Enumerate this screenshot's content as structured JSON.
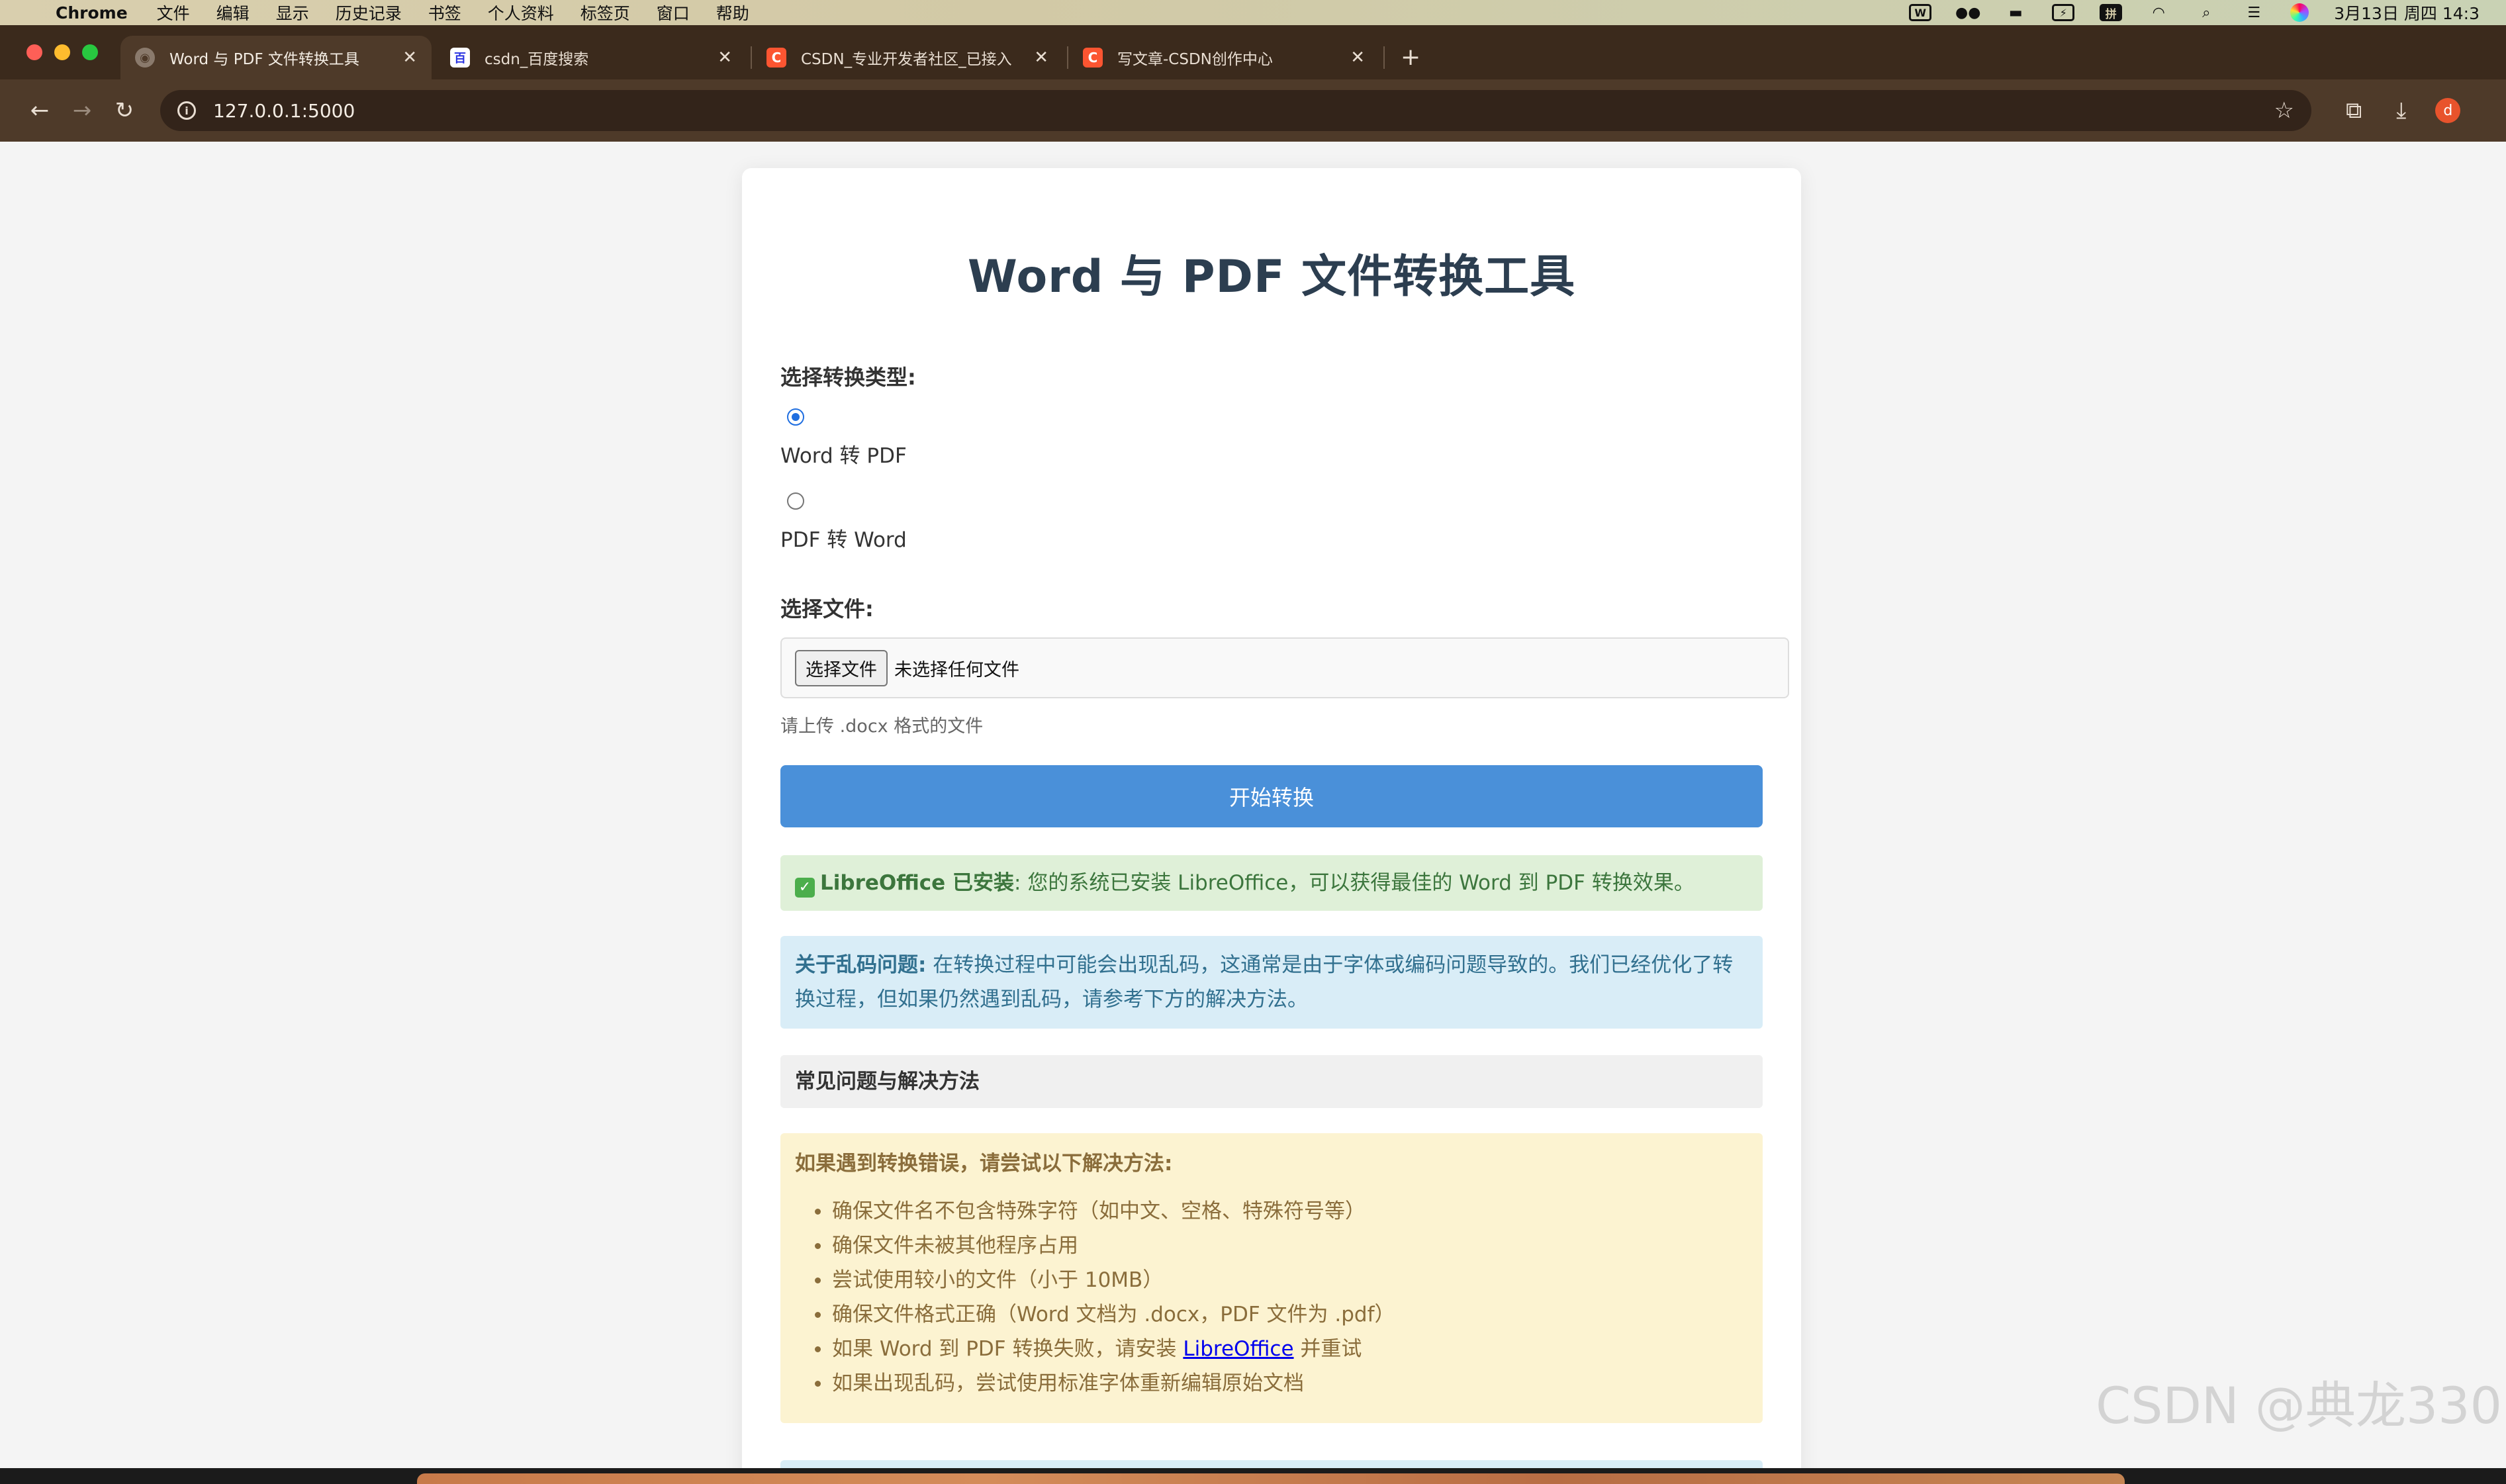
{
  "menubar": {
    "app_name": "Chrome",
    "menus": [
      "文件",
      "编辑",
      "显示",
      "历史记录",
      "书签",
      "个人资料",
      "标签页",
      "窗口",
      "帮助"
    ],
    "status_icons": [
      "wps-icon",
      "wechat-icon",
      "sofa-icon",
      "battery-icon",
      "input-method-icon",
      "wifi-icon",
      "search-icon",
      "control-center-icon",
      "siri-icon"
    ],
    "input_method": "拼",
    "clock": "3月13日 周四 14:3"
  },
  "tabs": [
    {
      "title": "Word 与 PDF 文件转换工具",
      "favicon": "globe-icon",
      "active": true
    },
    {
      "title": "csdn_百度搜索",
      "favicon": "baidu-icon",
      "active": false
    },
    {
      "title": "CSDN_专业开发者社区_已接入",
      "favicon": "csdn-icon",
      "active": false
    },
    {
      "title": "写文章-CSDN创作中心",
      "favicon": "csdn-icon",
      "active": false
    }
  ],
  "favicon_letters": {
    "baidu": "百",
    "csdn": "C"
  },
  "address_bar": {
    "url": "127.0.0.1:5000"
  },
  "profile_initial": "d",
  "page": {
    "title": "Word 与 PDF 文件转换工具",
    "conversion_type_label": "选择转换类型:",
    "options": [
      {
        "label": "Word 转 PDF",
        "checked": true
      },
      {
        "label": "PDF 转 Word",
        "checked": false
      }
    ],
    "file_label": "选择文件:",
    "file_button": "选择文件",
    "file_status": "未选择任何文件",
    "hint": "请上传 .docx 格式的文件",
    "convert_button": "开始转换",
    "success_alert": {
      "strong": "LibreOffice 已安装",
      "text": ": 您的系统已安装 LibreOffice，可以获得最佳的 Word 到 PDF 转换效果。"
    },
    "info_alert": {
      "strong": "关于乱码问题:",
      "text": " 在转换过程中可能会出现乱码，这通常是由于字体或编码问题导致的。我们已经优化了转换过程，但如果仍然遇到乱码，请参考下方的解决方法。"
    },
    "faq_header": "常见问题与解决方法",
    "warning": {
      "title": "如果遇到转换错误，请尝试以下解决方法:",
      "items": [
        "确保文件名不包含特殊字符（如中文、空格、特殊符号等）",
        "确保文件未被其他程序占用",
        "尝试使用较小的文件（小于 10MB）",
        "确保文件格式正确（Word 文档为 .docx，PDF 文件为 .pdf）"
      ],
      "libreoffice_item": {
        "before": "如果 Word 到 PDF 转换失败，请安装 ",
        "link": "LibreOffice",
        "after": " 并重试"
      },
      "last_item": "如果出现乱码，尝试使用标准字体重新编辑原始文档"
    }
  },
  "watermark": "CSDN @典龙330",
  "colors": {
    "primary_button": "#4a90d9",
    "success_bg": "#dff0d8",
    "info_bg": "#d9edf7",
    "warning_bg": "#fcf3d1",
    "chrome_frame": "#3b2a1c"
  }
}
